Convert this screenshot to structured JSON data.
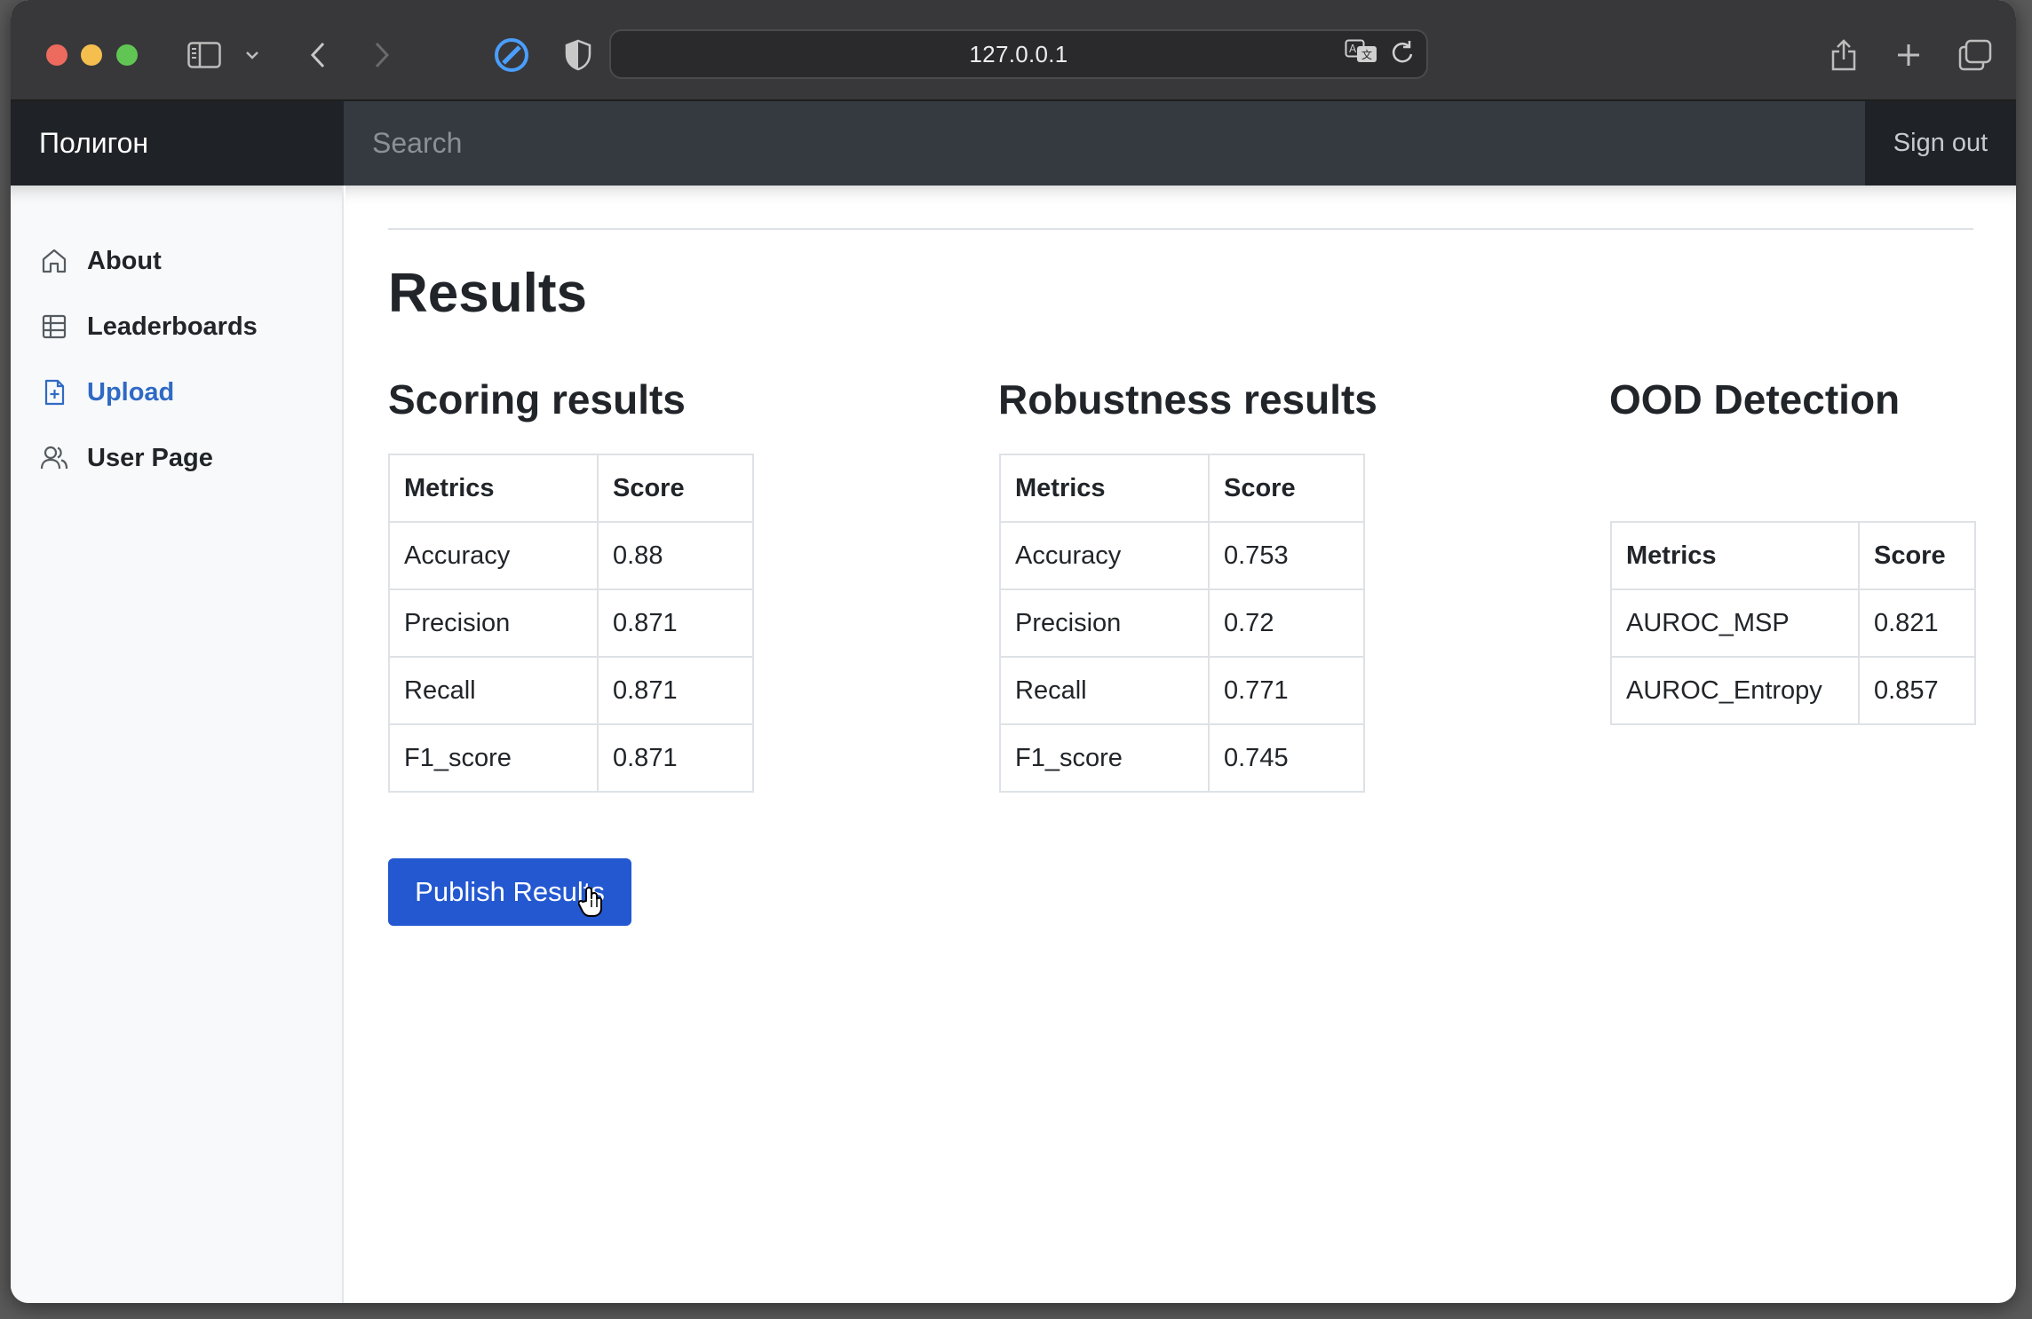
{
  "browser": {
    "url": "127.0.0.1"
  },
  "navbar": {
    "brand": "Полигон",
    "search_placeholder": "Search",
    "signout": "Sign out"
  },
  "sidebar": {
    "items": [
      {
        "label": "About",
        "icon": "house-icon",
        "active": false
      },
      {
        "label": "Leaderboards",
        "icon": "table-icon",
        "active": false
      },
      {
        "label": "Upload",
        "icon": "file-plus-icon",
        "active": true
      },
      {
        "label": "User Page",
        "icon": "users-icon",
        "active": false
      }
    ]
  },
  "main": {
    "title": "Results",
    "sections": [
      {
        "heading": "Scoring results",
        "columns": [
          "Metrics",
          "Score"
        ],
        "rows": [
          [
            "Accuracy",
            "0.88"
          ],
          [
            "Precision",
            "0.871"
          ],
          [
            "Recall",
            "0.871"
          ],
          [
            "F1_score",
            "0.871"
          ]
        ]
      },
      {
        "heading": "Robustness results",
        "columns": [
          "Metrics",
          "Score"
        ],
        "rows": [
          [
            "Accuracy",
            "0.753"
          ],
          [
            "Precision",
            "0.72"
          ],
          [
            "Recall",
            "0.771"
          ],
          [
            "F1_score",
            "0.745"
          ]
        ]
      },
      {
        "heading": "OOD Detection",
        "columns": [
          "Metrics",
          "Score"
        ],
        "rows": [
          [
            "AUROC_MSP",
            "0.821"
          ],
          [
            "AUROC_Entropy",
            "0.857"
          ]
        ]
      }
    ],
    "publish_label": "Publish Results"
  },
  "colors": {
    "accent": "#2358d1",
    "active_link": "#2f6ac4",
    "navbar": "#343a40"
  }
}
